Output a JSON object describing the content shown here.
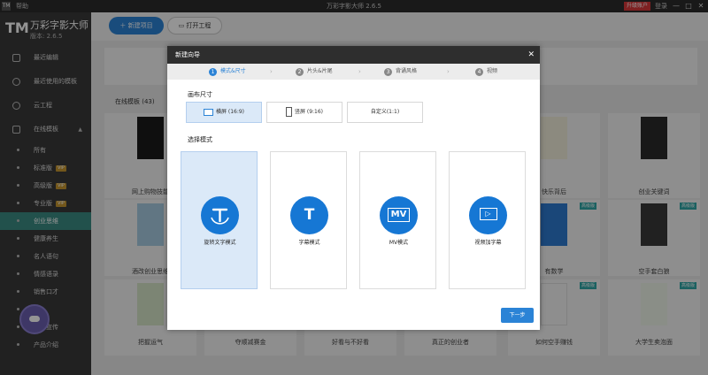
{
  "app": {
    "logo_small": "TM",
    "help_label": "帮助",
    "window_title": "万彩字影大师 2.6.5",
    "upgrade_label": "升级账户",
    "account_label": "登录",
    "min_symbol": "—",
    "max_symbol": "□",
    "close_symbol": "✕"
  },
  "brand": {
    "mark": "TM",
    "name": "万彩字影大师",
    "version": "版本: 2.6.5"
  },
  "sidebar": {
    "items": [
      {
        "label": "最近编辑"
      },
      {
        "label": "最近使用的模板"
      },
      {
        "label": "云工程"
      },
      {
        "label": "在线模板",
        "arrow": "▲"
      }
    ],
    "sub_items": [
      {
        "label": "所有",
        "vip": ""
      },
      {
        "label": "标准版",
        "vip": "VIP"
      },
      {
        "label": "高级版",
        "vip": "VIP"
      },
      {
        "label": "专业版",
        "vip": "VIP"
      },
      {
        "label": "创业思维",
        "vip": ""
      },
      {
        "label": "健康养生",
        "vip": ""
      },
      {
        "label": "名人语句",
        "vip": ""
      },
      {
        "label": "情感语录",
        "vip": ""
      },
      {
        "label": "销售口才",
        "vip": ""
      },
      {
        "label": "",
        "vip": ""
      },
      {
        "label": "公司宣传",
        "vip": ""
      },
      {
        "label": "产品介绍",
        "vip": ""
      }
    ]
  },
  "toolbar": {
    "new_project": "新建项目",
    "open_project": "打开工程"
  },
  "online": {
    "header": "在线模板 (43)",
    "cards_row1": [
      {
        "caption": "网上购物技能"
      },
      {
        "caption": ""
      },
      {
        "caption": ""
      },
      {
        "caption": ""
      },
      {
        "caption": "快乐背后"
      },
      {
        "caption": "创业关键词"
      }
    ],
    "cards_row2": [
      {
        "caption": "酒改创业思维"
      },
      {
        "caption": ""
      },
      {
        "caption": ""
      },
      {
        "caption": ""
      },
      {
        "caption": "有数学"
      },
      {
        "caption": "空手套白狼"
      }
    ],
    "cards_row3": [
      {
        "caption": "把握运气"
      },
      {
        "caption": "夺顺减赛金"
      },
      {
        "caption": "好看与不好看"
      },
      {
        "caption": "真正的创业者"
      },
      {
        "caption": "如何空手赚钱"
      },
      {
        "caption": "大学生卖泡面"
      }
    ],
    "tag": "高级版"
  },
  "dialog": {
    "title": "新建向导",
    "close": "✕",
    "steps": [
      {
        "num": "1",
        "label": "模式&尺寸"
      },
      {
        "num": "2",
        "label": "片头&片尾"
      },
      {
        "num": "3",
        "label": "背诵风格"
      },
      {
        "num": "4",
        "label": "视频"
      }
    ],
    "step_arrow": "›",
    "canvas_label": "画布尺寸",
    "sizes": [
      {
        "label": "横屏 (16:9)"
      },
      {
        "label": "竖屏 (9:16)"
      },
      {
        "label": "自定义(1:1)"
      }
    ],
    "mode_label": "选择模式",
    "modes": [
      {
        "label": "旋转文字模式",
        "glyph": "T"
      },
      {
        "label": "字幕模式",
        "glyph": "T"
      },
      {
        "label": "MV模式",
        "glyph": "MV"
      },
      {
        "label": "视频加字幕",
        "glyph": "▷"
      }
    ],
    "next": "下一步"
  },
  "colors": {
    "accent": "#2b83d6",
    "sidebar_active": "#3b8c84",
    "vip": "#c7962f",
    "upgrade": "#d9383a"
  }
}
